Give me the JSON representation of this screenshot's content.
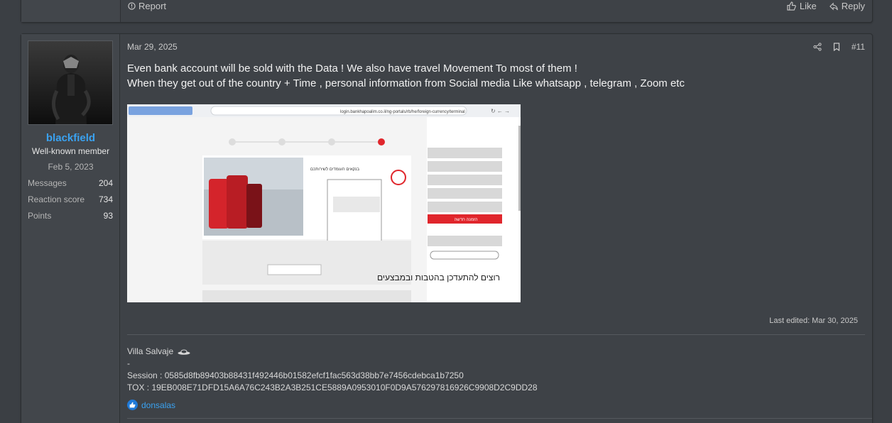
{
  "prev_post": {
    "report_label": "Report",
    "like_label": "Like",
    "reply_label": "Reply"
  },
  "post": {
    "date": "Mar 29, 2025",
    "number": "#11",
    "body_lines": [
      "Even bank account will be sold with the Data ! We also have travel Movement To most of them !",
      "When they get out of the country + Time , personal information from Social media Like whatsapp , telegram , Zoom etc"
    ],
    "last_edited": "Last edited: Mar 30, 2025",
    "attachment": {
      "url_text": "login.bankhapoalim.co.il/ng-portals/rb/he/foreign-currency/terminal",
      "hebrew_headline": "רוצים להתעדכן בהטבות ובמבצעים",
      "new_order_label": "הזמנה חדשה"
    }
  },
  "user": {
    "name": "blackfield",
    "title": "Well-known member",
    "joined": "Feb 5, 2023",
    "stats": [
      {
        "label": "Messages",
        "value": "204"
      },
      {
        "label": "Reaction score",
        "value": "734"
      },
      {
        "label": "Points",
        "value": "93"
      }
    ]
  },
  "signature": {
    "line1": "Villa Salvaje",
    "line2": "-",
    "session": "Session : 0585d8fb89403b88431f492446b01582efcf1fac563d38bb7e7456cdebca1b7250",
    "tox": "TOX : 19EB008E71DFD15A6A76C243B2A3B251CE5889A0953010F0D9A576297816926C9908D2C9DD28"
  },
  "reactions": {
    "user": "donsalas"
  },
  "colors": {
    "accent": "#3aa2f1",
    "background": "#3b3f44",
    "post_bg": "#3e4247"
  }
}
